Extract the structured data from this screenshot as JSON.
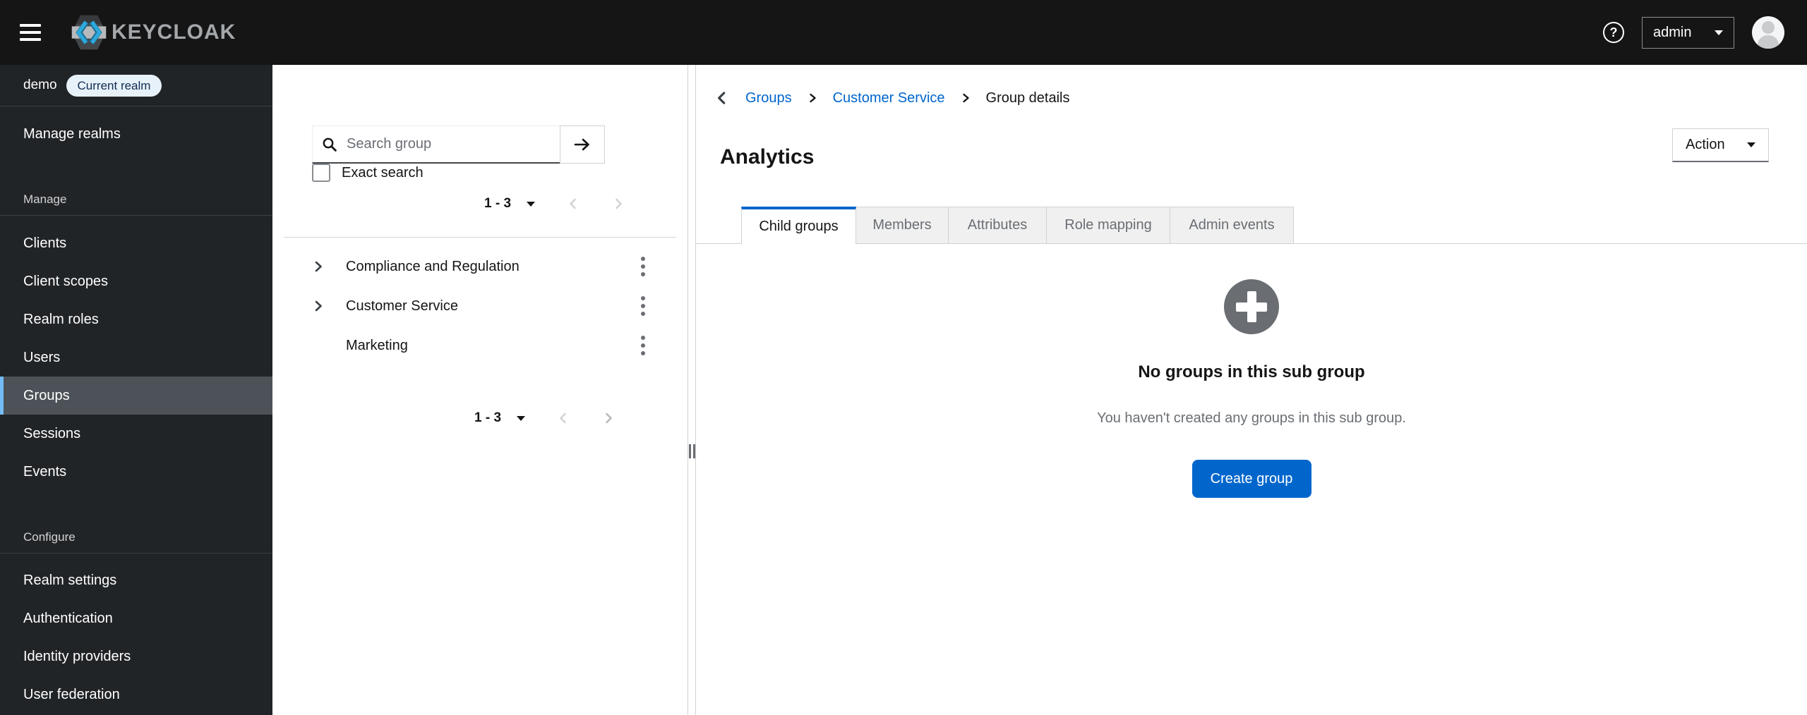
{
  "header": {
    "brand": "KEYCLOAK",
    "user": "admin"
  },
  "sidebar": {
    "realm_name": "demo",
    "realm_badge": "Current realm",
    "manage_realms": "Manage realms",
    "sections": [
      {
        "title": "Manage",
        "items": [
          "Clients",
          "Client scopes",
          "Realm roles",
          "Users",
          "Groups",
          "Sessions",
          "Events"
        ],
        "selected_item": "Groups"
      },
      {
        "title": "Configure",
        "items": [
          "Realm settings",
          "Authentication",
          "Identity providers",
          "User federation"
        ]
      }
    ]
  },
  "group_tree_panel": {
    "search_placeholder": "Search group",
    "exact_search_label": "Exact search",
    "pagination_range": "1 - 3",
    "groups": [
      {
        "name": "Compliance and Regulation",
        "expandable": true
      },
      {
        "name": "Customer Service",
        "expandable": true
      },
      {
        "name": "Marketing",
        "expandable": false
      }
    ]
  },
  "main": {
    "breadcrumb": {
      "items": [
        "Groups",
        "Customer Service"
      ],
      "current": "Group details"
    },
    "title": "Analytics",
    "action_label": "Action",
    "tabs": [
      "Child groups",
      "Members",
      "Attributes",
      "Role mapping",
      "Admin events"
    ],
    "active_tab": "Child groups",
    "empty_state": {
      "title": "No groups in this sub group",
      "description": "You haven't created any groups in this sub group.",
      "button": "Create group"
    }
  },
  "colors": {
    "accent": "#0066cc",
    "header_bg": "#151515",
    "sidebar_bg": "#212427",
    "selected_indicator": "#73bcf7",
    "muted_text": "#6a6e73"
  }
}
